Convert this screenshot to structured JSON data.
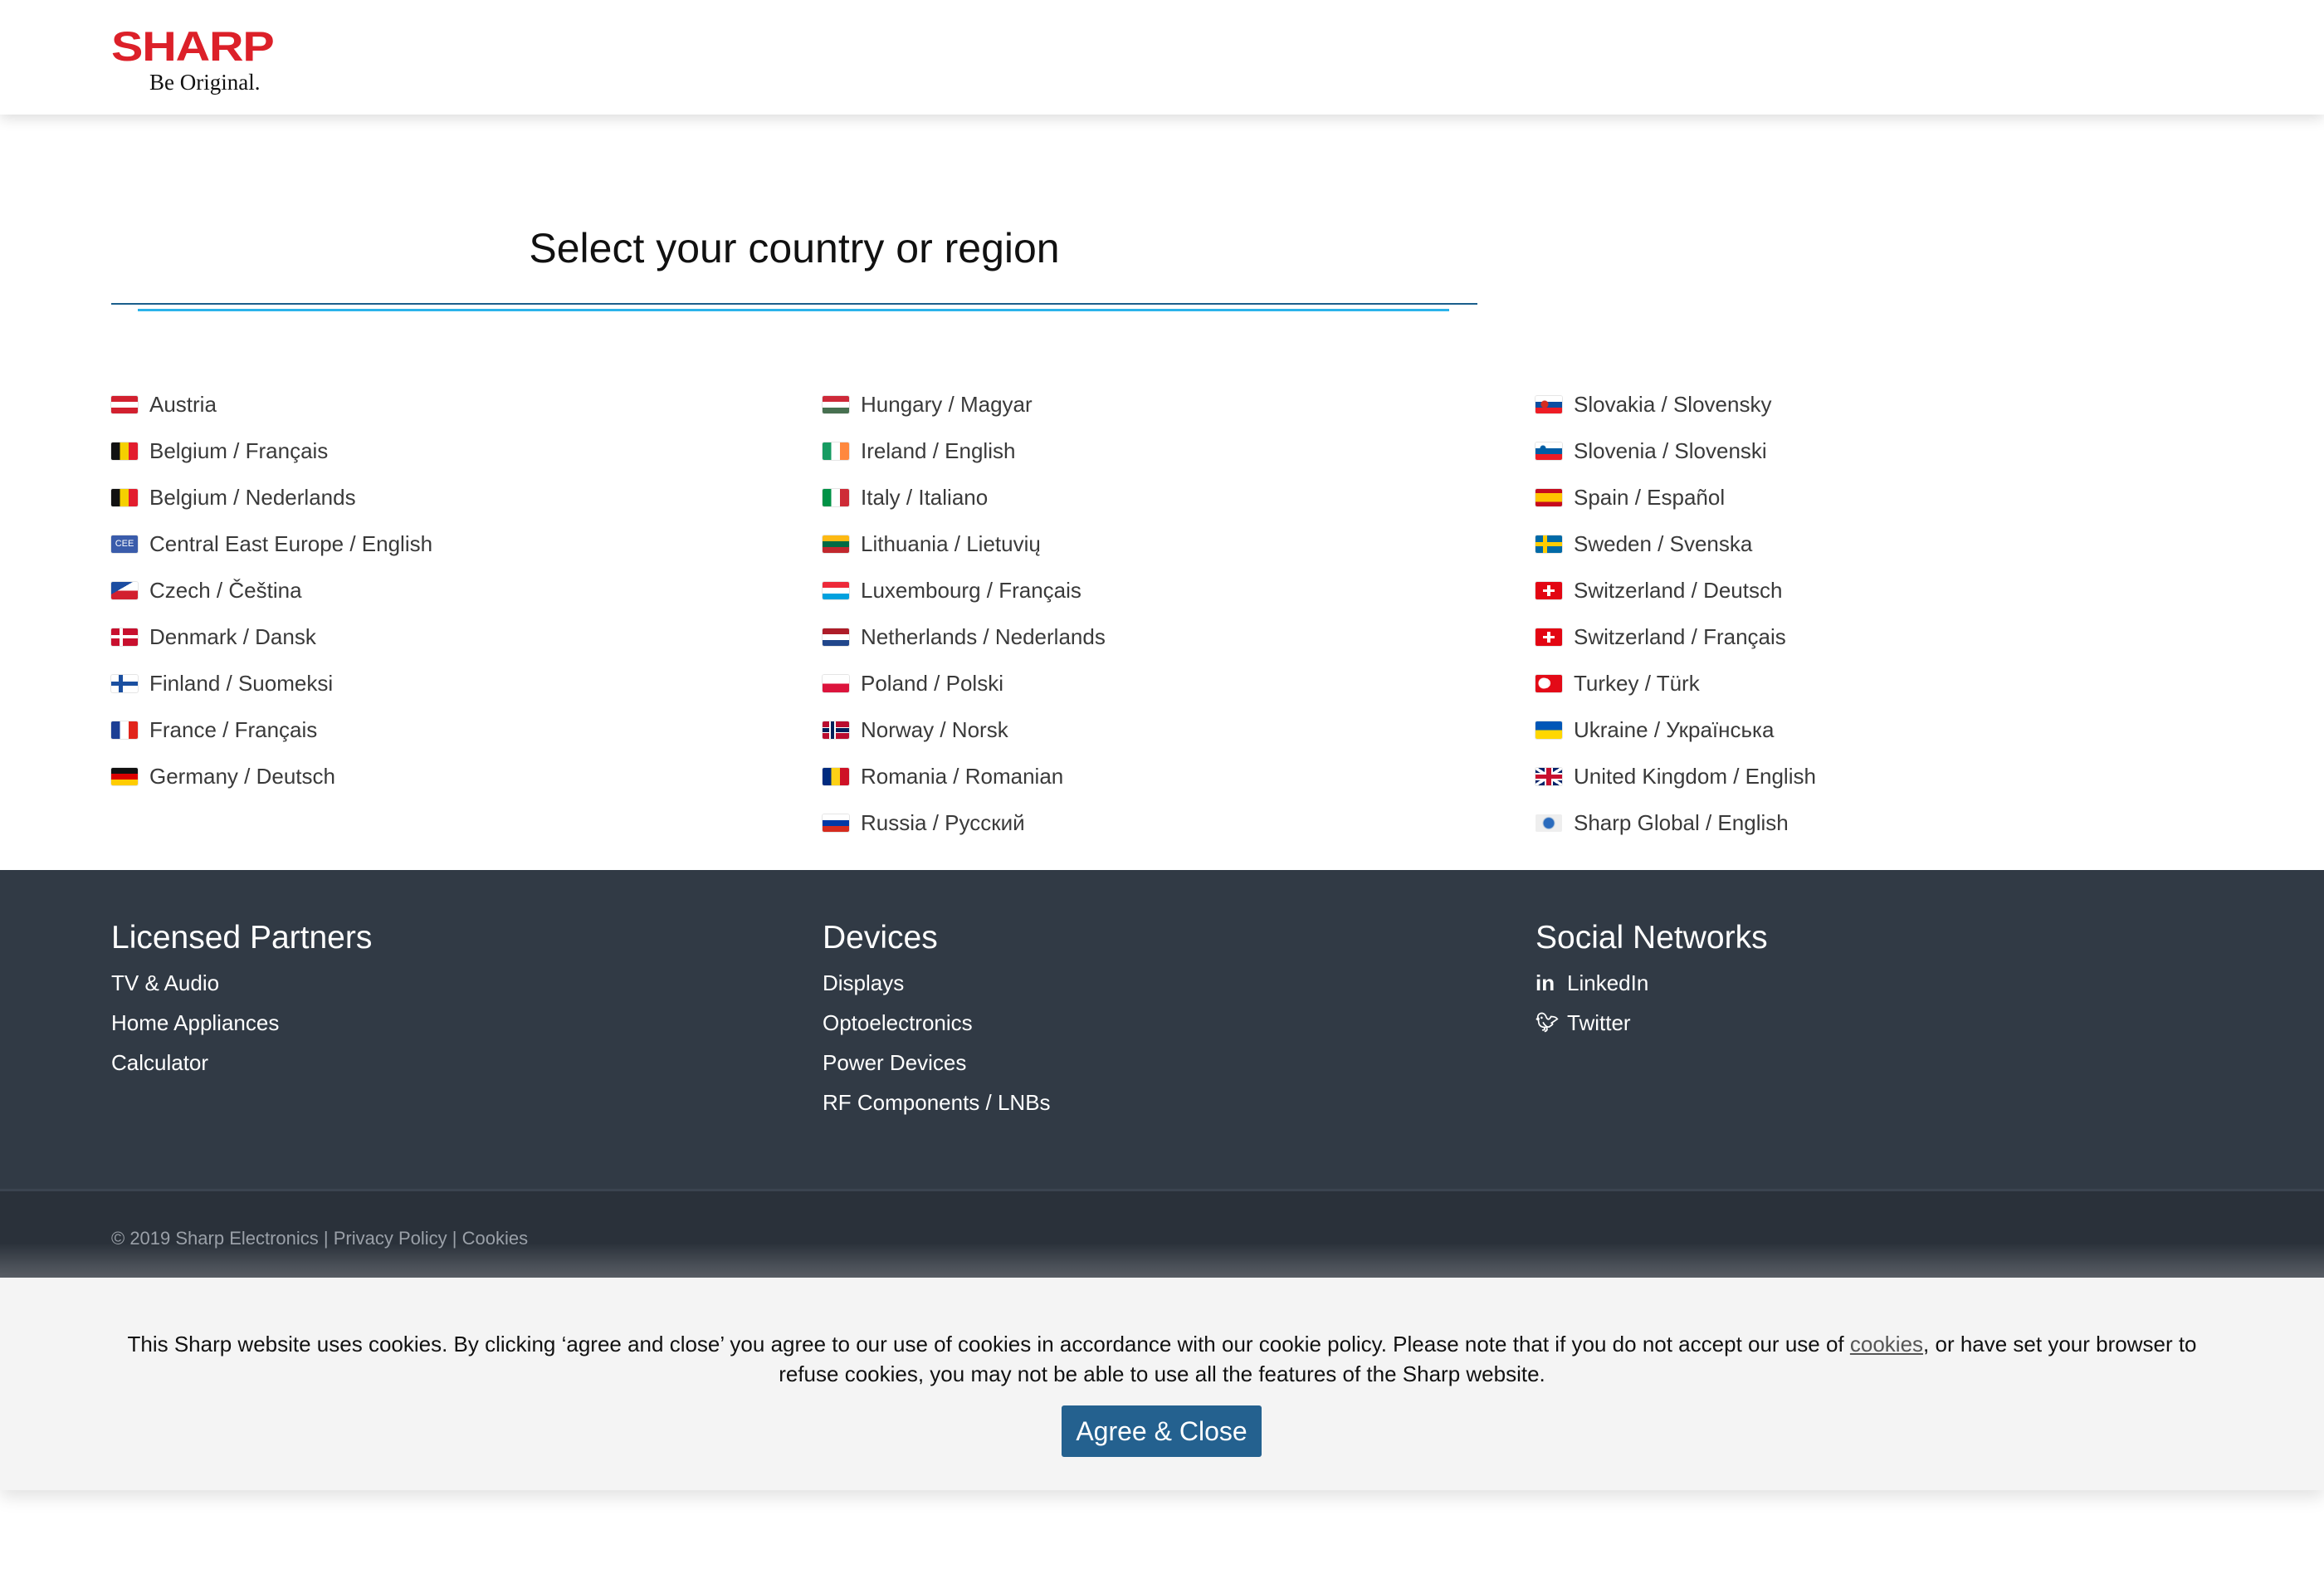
{
  "header": {
    "logo_brand": "SHARP",
    "logo_tagline": "Be Original."
  },
  "title": "Select your country or region",
  "columns": [
    [
      {
        "flag": "at",
        "label": "Austria"
      },
      {
        "flag": "be",
        "label": "Belgium / Français"
      },
      {
        "flag": "be",
        "label": "Belgium / Nederlands"
      },
      {
        "flag": "eu",
        "label": "Central East Europe / English",
        "flag_text": "CEE"
      },
      {
        "flag": "cz",
        "label": "Czech / Čeština"
      },
      {
        "flag": "dk",
        "label": "Denmark / Dansk"
      },
      {
        "flag": "fi",
        "label": "Finland / Suomeksi"
      },
      {
        "flag": "fr",
        "label": "France / Français"
      },
      {
        "flag": "de",
        "label": "Germany / Deutsch"
      }
    ],
    [
      {
        "flag": "hu",
        "label": "Hungary / Magyar"
      },
      {
        "flag": "ie",
        "label": "Ireland / English"
      },
      {
        "flag": "it",
        "label": "Italy / Italiano"
      },
      {
        "flag": "lt",
        "label": "Lithuania / Lietuvių"
      },
      {
        "flag": "lu",
        "label": "Luxembourg / Français"
      },
      {
        "flag": "nl",
        "label": "Netherlands / Nederlands"
      },
      {
        "flag": "pl",
        "label": "Poland / Polski"
      },
      {
        "flag": "no",
        "label": "Norway / Norsk"
      },
      {
        "flag": "ro",
        "label": "Romania / Romanian"
      },
      {
        "flag": "ru",
        "label": "Russia / Русский"
      }
    ],
    [
      {
        "flag": "sk",
        "label": "Slovakia / Slovensky"
      },
      {
        "flag": "si",
        "label": "Slovenia / Slovenski"
      },
      {
        "flag": "es",
        "label": "Spain / Español"
      },
      {
        "flag": "se",
        "label": "Sweden / Svenska"
      },
      {
        "flag": "ch",
        "label": "Switzerland / Deutsch"
      },
      {
        "flag": "ch",
        "label": "Switzerland / Français"
      },
      {
        "flag": "tr",
        "label": "Turkey / Türk"
      },
      {
        "flag": "ua",
        "label": "Ukraine / Українська"
      },
      {
        "flag": "gb",
        "label": "United Kingdom / English"
      },
      {
        "flag": "gl",
        "label": "Sharp Global / English"
      }
    ]
  ],
  "footer": {
    "licensed": {
      "heading": "Licensed Partners",
      "links": [
        "TV & Audio",
        "Home Appliances",
        "Calculator"
      ]
    },
    "devices": {
      "heading": "Devices",
      "links": [
        "Displays",
        "Optoelectronics",
        "Power Devices",
        "RF Components / LNBs"
      ]
    },
    "social": {
      "heading": "Social Networks",
      "links": [
        {
          "icon": "linkedin-icon",
          "glyph": "in",
          "label": "LinkedIn"
        },
        {
          "icon": "twitter-icon",
          "glyph": "🐦",
          "label": "Twitter"
        }
      ]
    },
    "copyright": "© 2019 Sharp Electronics",
    "sep": " | ",
    "privacy": "Privacy Policy",
    "cookies": "Cookies"
  },
  "cookie_banner": {
    "text_before": "This Sharp website uses cookies. By clicking ‘agree and close’ you agree to our use of cookies in accordance with our cookie policy. Please note that if you do not accept our use of ",
    "link": "cookies",
    "text_after": ", or have set your browser to refuse cookies, you may not be able to use all the features of the Sharp website.",
    "button": "Agree & Close"
  },
  "colors": {
    "brand": "#dc2029",
    "footer_bg": "#313a45",
    "button": "#24618f"
  }
}
